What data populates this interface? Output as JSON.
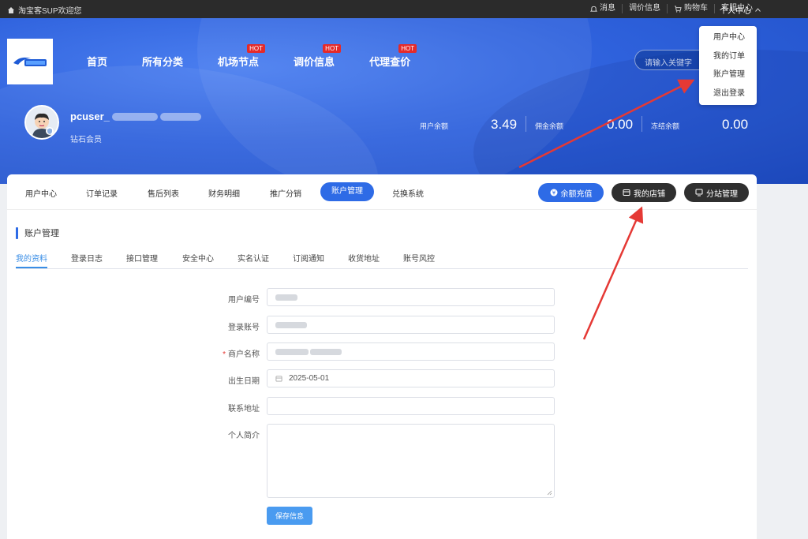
{
  "topbar": {
    "welcome": "淘宝客SUP欢迎您",
    "links": [
      "消息",
      "调价信息",
      "购物车",
      "客服中心"
    ],
    "personal": "个人中心"
  },
  "nav": {
    "items": [
      {
        "label": "首页",
        "hot": ""
      },
      {
        "label": "所有分类",
        "hot": ""
      },
      {
        "label": "机场节点",
        "hot": "HOT"
      },
      {
        "label": "调价信息",
        "hot": "HOT"
      },
      {
        "label": "代理查价",
        "hot": "HOT"
      }
    ],
    "search_placeholder": "请输入关键字"
  },
  "dropdown": [
    "用户中心",
    "我的订单",
    "账户管理",
    "退出登录"
  ],
  "profile": {
    "username_prefix": "pcuser_",
    "member_level": "钻石会员",
    "balance_label": "用户余额",
    "balance_value": "3.49",
    "commission_label": "佣金余额",
    "commission_value": "0.00",
    "frozen_label": "冻结余额",
    "frozen_value": "0.00"
  },
  "tabs": [
    "用户中心",
    "订单记录",
    "售后列表",
    "财务明细",
    "推广分销",
    "账户管理",
    "兑换系统"
  ],
  "actions": {
    "recharge": "余额充值",
    "my_shop": "我的店铺",
    "substation": "分站管理"
  },
  "section_title": "账户管理",
  "subtabs": [
    "我的资料",
    "登录日志",
    "接口管理",
    "安全中心",
    "实名认证",
    "订阅通知",
    "收货地址",
    "账号风控"
  ],
  "form": {
    "user_id_label": "用户编号",
    "login_account_label": "登录账号",
    "merchant_name_label": "商户名称",
    "birth_date_label": "出生日期",
    "birth_date_value": "2025-05-01",
    "address_label": "联系地址",
    "bio_label": "个人简介",
    "save_label": "保存信息"
  },
  "colors": {
    "accent": "#2e6be6",
    "topbar": "#2b2b2b",
    "annotation_arrow": "#e53935",
    "hot_badge": "#e42a2a"
  }
}
